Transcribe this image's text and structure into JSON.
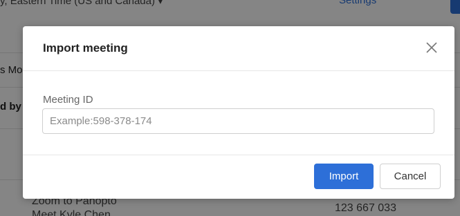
{
  "background": {
    "top_text": "y, Eastern Time (US and Canada) ▾",
    "top_link": "Settings",
    "left_text_1": "s Mo",
    "left_text_2": "d by",
    "row_name": "Zoom to Panopto",
    "row_name_2": "Meet Kyle Chen",
    "row_meeting_id": "123 667 033"
  },
  "modal": {
    "title": "Import meeting",
    "close_label": "×",
    "field": {
      "label": "Meeting ID",
      "value": "",
      "placeholder": "Example:598-378-174"
    },
    "buttons": {
      "import_label": "Import",
      "cancel_label": "Cancel"
    }
  },
  "colors": {
    "accent": "#2d6fd8",
    "overlay": "rgba(0,0,0,0.48)"
  }
}
